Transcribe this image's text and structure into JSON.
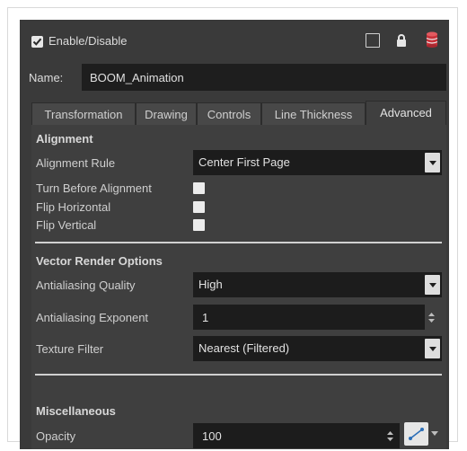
{
  "header": {
    "enable_label": "Enable/Disable",
    "enable_checked": true,
    "icons": [
      "view-toggle-box-icon",
      "lock-icon",
      "database-icon"
    ]
  },
  "name": {
    "label": "Name:",
    "value": "BOOM_Animation"
  },
  "tabs": [
    {
      "label": "Transformation",
      "active": false
    },
    {
      "label": "Drawing",
      "active": false
    },
    {
      "label": "Controls",
      "active": false
    },
    {
      "label": "Line Thickness",
      "active": false
    },
    {
      "label": "Advanced",
      "active": true
    }
  ],
  "alignment": {
    "title": "Alignment",
    "rule_label": "Alignment Rule",
    "rule_value": "Center First Page",
    "turn_label": "Turn Before Alignment",
    "flip_h_label": "Flip Horizontal",
    "flip_v_label": "Flip Vertical"
  },
  "vector": {
    "title": "Vector Render Options",
    "aa_quality_label": "Antialiasing Quality",
    "aa_quality_value": "High",
    "aa_exponent_label": "Antialiasing Exponent",
    "aa_exponent_value": "1",
    "texture_label": "Texture Filter",
    "texture_value": "Nearest (Filtered)"
  },
  "misc": {
    "title": "Miscellaneous",
    "opacity_label": "Opacity",
    "opacity_value": "100"
  },
  "colors": {
    "panel": "#3a3a3a",
    "field": "#1c1c1c",
    "separator": "#d0d0d0"
  }
}
